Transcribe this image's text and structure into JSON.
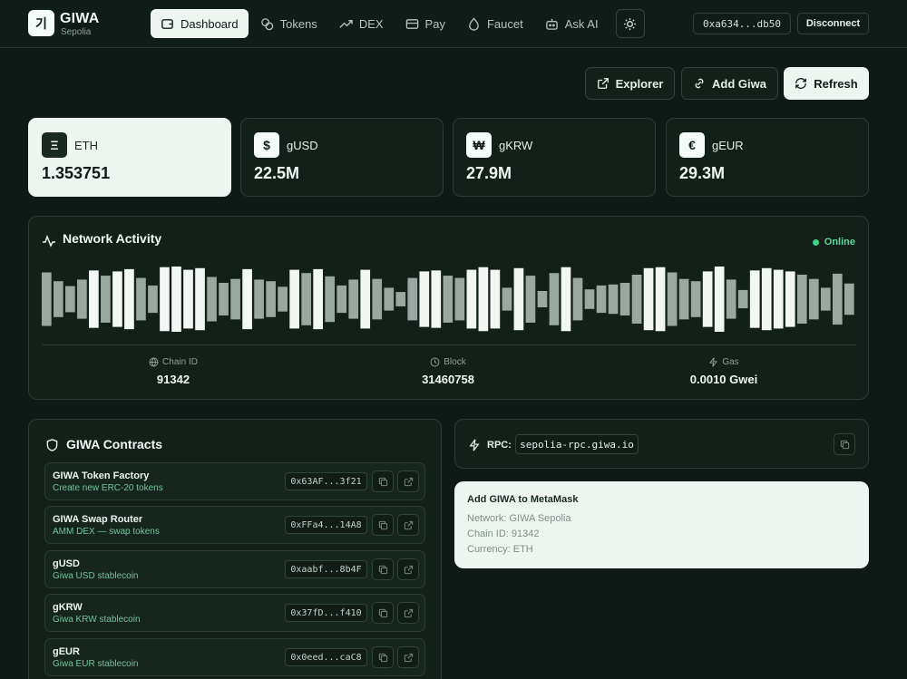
{
  "header": {
    "brand_logo": "기",
    "brand_name": "GIWA",
    "brand_sub": "Sepolia",
    "nav": [
      {
        "label": "Dashboard",
        "icon": "wallet-icon",
        "active": true
      },
      {
        "label": "Tokens",
        "icon": "coins-icon",
        "active": false
      },
      {
        "label": "DEX",
        "icon": "trending-up-icon",
        "active": false
      },
      {
        "label": "Pay",
        "icon": "card-icon",
        "active": false
      },
      {
        "label": "Faucet",
        "icon": "droplet-icon",
        "active": false
      },
      {
        "label": "Ask AI",
        "icon": "bot-icon",
        "active": false
      }
    ],
    "address": "0xa634...db50",
    "disconnect_label": "Disconnect"
  },
  "actions": {
    "explorer_label": "Explorer",
    "add_giwa_label": "Add Giwa",
    "refresh_label": "Refresh"
  },
  "tokens": [
    {
      "icon_glyph": "Ξ",
      "symbol": "ETH",
      "value": "1.353751",
      "active": true
    },
    {
      "icon_glyph": "$",
      "symbol": "gUSD",
      "value": "22.5M",
      "active": false
    },
    {
      "icon_glyph": "₩",
      "symbol": "gKRW",
      "value": "27.9M",
      "active": false
    },
    {
      "icon_glyph": "€",
      "symbol": "gEUR",
      "value": "29.3M",
      "active": false
    }
  ],
  "network": {
    "title": "Network Activity",
    "status": "Online",
    "activity_levels": [
      0.82,
      0.55,
      0.4,
      0.6,
      0.88,
      0.72,
      0.85,
      0.92,
      0.65,
      0.42,
      0.98,
      1.0,
      0.9,
      0.95,
      0.68,
      0.5,
      0.62,
      0.92,
      0.6,
      0.55,
      0.38,
      0.9,
      0.8,
      0.92,
      0.7,
      0.42,
      0.6,
      0.9,
      0.62,
      0.35,
      0.22,
      0.65,
      0.85,
      0.88,
      0.72,
      0.65,
      0.9,
      0.98,
      0.9,
      0.35,
      0.95,
      0.72,
      0.25,
      0.8,
      0.98,
      0.65,
      0.3,
      0.42,
      0.45,
      0.5,
      0.75,
      0.95,
      0.98,
      0.82,
      0.62,
      0.55,
      0.85,
      1.0,
      0.6,
      0.28,
      0.88,
      0.95,
      0.9,
      0.85,
      0.75,
      0.62,
      0.35,
      0.78,
      0.48
    ],
    "chain_id_label": "Chain ID",
    "chain_id": "91342",
    "block_label": "Block",
    "block": "31460758",
    "gas_label": "Gas",
    "gas": "0.0010 Gwei"
  },
  "contracts": {
    "title": "GIWA Contracts",
    "items": [
      {
        "name": "GIWA Token Factory",
        "desc": "Create new ERC-20 tokens",
        "address": "0x63AF...3f21"
      },
      {
        "name": "GIWA Swap Router",
        "desc": "AMM DEX — swap tokens",
        "address": "0xFFa4...14A8"
      },
      {
        "name": "gUSD",
        "desc": "Giwa USD stablecoin",
        "address": "0xaabf...8b4F"
      },
      {
        "name": "gKRW",
        "desc": "Giwa KRW stablecoin",
        "address": "0x37fD...f410"
      },
      {
        "name": "gEUR",
        "desc": "Giwa EUR stablecoin",
        "address": "0x0eed...caC8"
      }
    ]
  },
  "rpc": {
    "label": "RPC:",
    "url": "sepolia-rpc.giwa.io"
  },
  "metamask": {
    "title": "Add GIWA to MetaMask",
    "network_line": "Network: GIWA Sepolia",
    "chain_line": "Chain ID: 91342",
    "currency_line": "Currency: ETH"
  }
}
